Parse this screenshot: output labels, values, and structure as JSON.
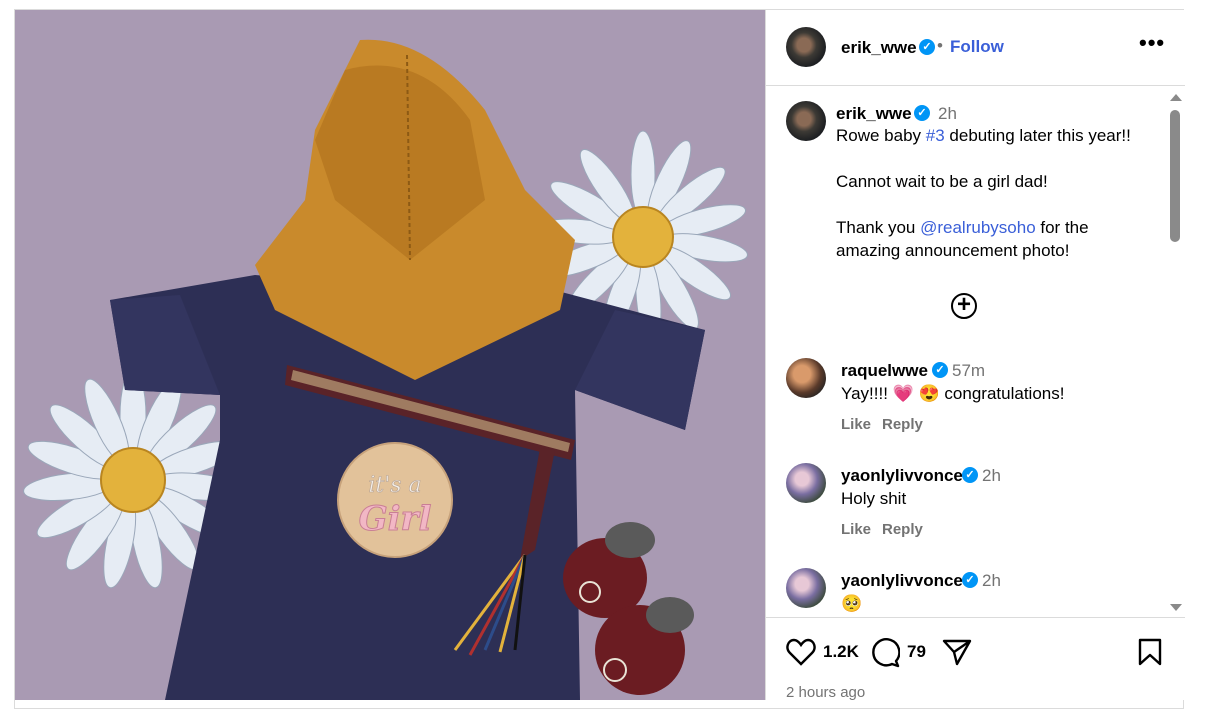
{
  "post": {
    "author": "erik_wwe",
    "follow_label": "Follow",
    "separator": "•",
    "more_label": "•••"
  },
  "caption": {
    "author": "erik_wwe",
    "time": "2h",
    "line1_pre": "Rowe baby ",
    "line1_tag": "#3",
    "line1_post": " debuting later this year!!",
    "line2": "Cannot wait to be a girl dad!",
    "line3_pre": "Thank you ",
    "line3_mention": "@realrubysoho",
    "line3_post": " for the amazing announcement photo!"
  },
  "comments": [
    {
      "user": "raquelwwe",
      "time": "57m",
      "text": "Yay!!!! 💗 😍 congratulations!",
      "like_label": "Like",
      "reply_label": "Reply"
    },
    {
      "user": "yaonlylivvonce",
      "time": "2h",
      "text": "Holy shit",
      "like_label": "Like",
      "reply_label": "Reply"
    },
    {
      "user": "yaonlylivvonce",
      "time": "2h",
      "text": "🥺"
    }
  ],
  "actions": {
    "likes": "1.2K",
    "comments": "79",
    "posted": "2 hours ago"
  },
  "image": {
    "sign_line1": "it's a",
    "sign_line2": "Girl"
  },
  "icons": [
    "verified-icon",
    "more-icon",
    "add-comment-icon",
    "heart-icon",
    "comment-icon",
    "share-icon",
    "bookmark-icon"
  ],
  "colors": {
    "accent": "#3a5fd8",
    "verified": "#0095f6",
    "muted": "#737373",
    "photo_bg": "#a99ab3"
  }
}
